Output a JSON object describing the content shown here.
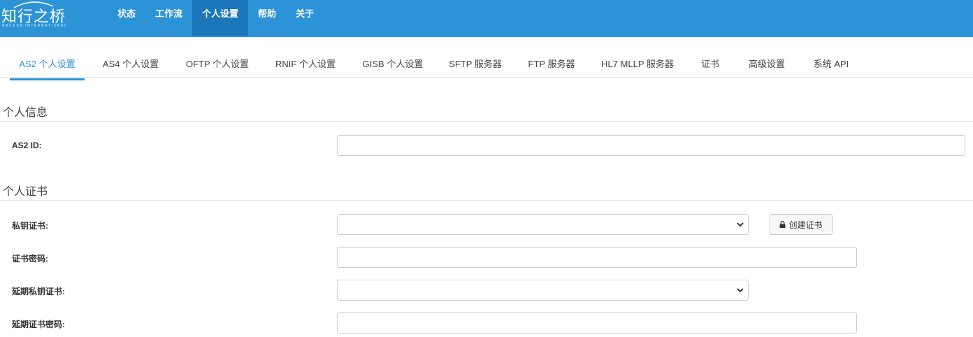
{
  "logo": {
    "text": "知行之桥",
    "subtext": "ARCESB INTERNATIONAL"
  },
  "nav": [
    {
      "label": "状态"
    },
    {
      "label": "工作流"
    },
    {
      "label": "个人设置",
      "active": true
    },
    {
      "label": "帮助"
    },
    {
      "label": "关于"
    }
  ],
  "tabs": [
    {
      "label": "AS2 个人设置",
      "active": true
    },
    {
      "label": "AS4 个人设置"
    },
    {
      "label": "OFTP 个人设置"
    },
    {
      "label": "RNIF 个人设置"
    },
    {
      "label": "GISB 个人设置"
    },
    {
      "label": "SFTP 服务器"
    },
    {
      "label": "FTP 服务器"
    },
    {
      "label": "HL7 MLLP 服务器"
    },
    {
      "label": "证书"
    },
    {
      "label": "高级设置"
    },
    {
      "label": "系统 API"
    }
  ],
  "personal_info": {
    "title": "个人信息",
    "as2_id_label": "AS2 ID:",
    "as2_id_value": ""
  },
  "personal_cert": {
    "title": "个人证书",
    "private_cert_label": "私钥证书:",
    "create_cert_button": "创建证书",
    "cert_password_label": "证书密码:",
    "extended_private_cert_label": "延期私钥证书:",
    "extended_cert_password_label": "延期证书密码:"
  },
  "colors": {
    "header": "#2c93d6",
    "header_active": "#1c77ba",
    "tab_active": "#2c93d6"
  },
  "icons": {
    "lock": "lock-icon",
    "chevron": "chevron-down-icon"
  }
}
